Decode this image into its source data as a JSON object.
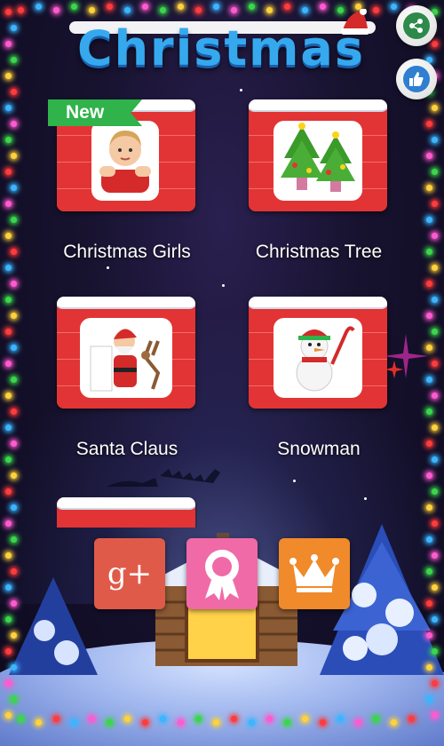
{
  "header": {
    "title": "Christmas",
    "share_icon": "share-icon",
    "like_icon": "thumbs-up-icon"
  },
  "categories": [
    {
      "label": "Christmas Girls",
      "badge": "New",
      "icon": "girl-photo"
    },
    {
      "label": "Christmas Tree",
      "icon": "christmas-trees-image"
    },
    {
      "label": "Santa Claus",
      "icon": "santa-claus-image"
    },
    {
      "label": "Snowman",
      "icon": "snowman-image"
    }
  ],
  "actions": [
    {
      "label": "g+",
      "icon": "google-plus-icon",
      "color": "#e05a4a"
    },
    {
      "icon": "award-ribbon-icon",
      "color": "#f06aa8"
    },
    {
      "icon": "crown-icon",
      "color": "#f08a2a"
    }
  ],
  "colors": {
    "board_red": "#d42a2a",
    "ribbon_green": "#2fb34a",
    "title_blue": "#36a9ee",
    "share_green": "#2e8a4a",
    "like_blue": "#2f7fd0"
  }
}
